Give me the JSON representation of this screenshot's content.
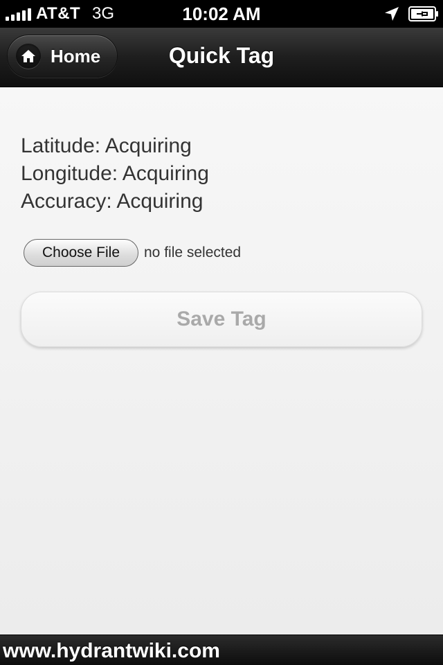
{
  "status_bar": {
    "carrier": "AT&T",
    "network": "3G",
    "time": "10:02 AM",
    "signal_bars": 5
  },
  "header": {
    "home_label": "Home",
    "title": "Quick Tag"
  },
  "location": {
    "latitude": "Latitude: Acquiring",
    "longitude": "Longitude: Acquiring",
    "accuracy": "Accuracy: Acquiring"
  },
  "file_input": {
    "button_label": "Choose File",
    "status": "no file selected"
  },
  "save_button": {
    "label": "Save Tag"
  },
  "footer": {
    "text": "www.hydrantwiki.com"
  },
  "icons": {
    "home": "home-icon",
    "location": "location-arrow-icon",
    "battery": "battery-charging-icon",
    "signal": "signal-bars-icon"
  },
  "colors": {
    "header_bg": "#1e1e1e",
    "content_bg": "#f3f3f3",
    "save_text_disabled": "#a9a9a9"
  }
}
